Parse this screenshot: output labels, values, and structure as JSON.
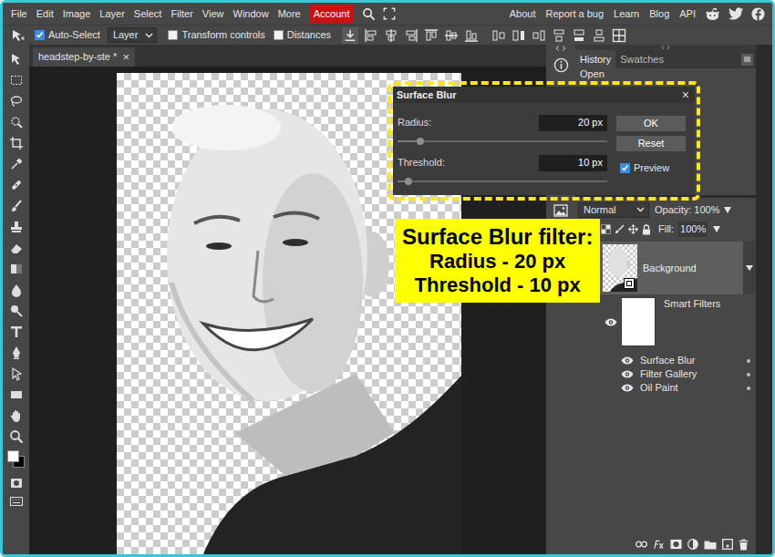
{
  "menu_bar": {
    "items": [
      {
        "label": "File",
        "highlighted": false
      },
      {
        "label": "Edit",
        "highlighted": false
      },
      {
        "label": "Image",
        "highlighted": false
      },
      {
        "label": "Layer",
        "highlighted": false
      },
      {
        "label": "Select",
        "highlighted": false
      },
      {
        "label": "Filter",
        "highlighted": false
      },
      {
        "label": "View",
        "highlighted": false
      },
      {
        "label": "Window",
        "highlighted": false
      },
      {
        "label": "More",
        "highlighted": false
      },
      {
        "label": "Account",
        "highlighted": true
      }
    ],
    "links": [
      "About",
      "Report a bug",
      "Learn",
      "Blog",
      "API"
    ]
  },
  "options_bar": {
    "auto_select": {
      "label": "Auto-Select",
      "checked": true
    },
    "auto_select_target": "Layer",
    "transform_controls": {
      "label": "Transform controls",
      "checked": false
    },
    "distances": {
      "label": "Distances",
      "checked": false
    }
  },
  "toolbar": {
    "foreground_color": "#ffffff",
    "background_color": "#000000"
  },
  "document_tab": {
    "title": "headstep-by-ste *",
    "close": "×"
  },
  "history_panel": {
    "tabs": [
      {
        "label": "History",
        "selected": true
      },
      {
        "label": "Swatches",
        "selected": false
      }
    ],
    "items": [
      "Open"
    ]
  },
  "surface_blur_dialog": {
    "title": "Surface Blur",
    "close": "×",
    "fields": [
      {
        "label": "Radius:",
        "value": "20 px",
        "level": 0.11
      },
      {
        "label": "Threshold:",
        "value": "10 px",
        "level": 0.05
      }
    ],
    "buttons": [
      "OK",
      "Reset"
    ],
    "preview": {
      "label": "Preview",
      "checked": true
    }
  },
  "annotation": {
    "title": "Surface Blur filter:",
    "lines": [
      "Radius - 20 px",
      "Threshold - 10 px"
    ]
  },
  "layers_panel": {
    "blend_mode": "Normal",
    "opacity": {
      "label": "Opacity:",
      "value": "100%"
    },
    "fill": {
      "label": "Fill:",
      "value": "100%"
    },
    "layers": [
      {
        "name": "Background",
        "selected": true,
        "smart_object": true
      }
    ],
    "smart_filters": {
      "label": "Smart Filters",
      "visible": true,
      "filters": [
        {
          "name": "Surface Blur",
          "visible": true
        },
        {
          "name": "Filter Gallery",
          "visible": true
        },
        {
          "name": "Oil Paint",
          "visible": true
        }
      ]
    }
  }
}
